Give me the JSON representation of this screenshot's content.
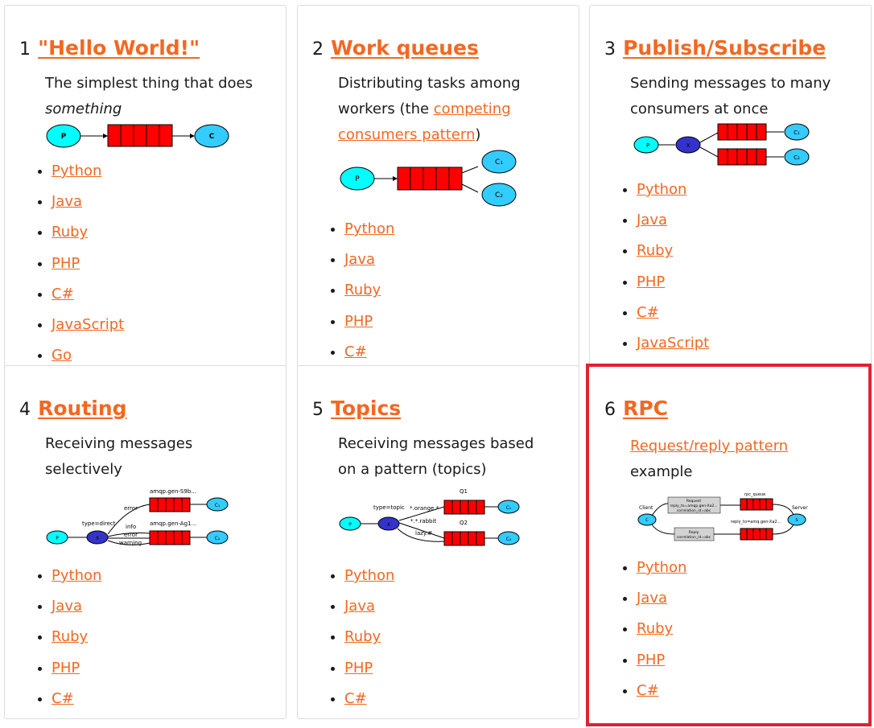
{
  "cards": [
    {
      "number": "1",
      "title": "\"Hello World!\"",
      "desc": {
        "text": "The simplest thing that does",
        "italic": "something"
      },
      "diagram": {
        "p": "P",
        "c": "C"
      },
      "languages": [
        "Python",
        "Java",
        "Ruby",
        "PHP",
        "C#",
        "JavaScript",
        "Go"
      ]
    },
    {
      "number": "2",
      "title": "Work queues",
      "desc": {
        "line1": "Distributing tasks among",
        "line2_pre": "workers (the ",
        "link_a": "competing",
        "link_b": "consumers pattern",
        "tail": ")"
      },
      "diagram": {
        "p": "P",
        "c1": "C₁",
        "c2": "C₂"
      },
      "languages": [
        "Python",
        "Java",
        "Ruby",
        "PHP",
        "C#"
      ]
    },
    {
      "number": "3",
      "title": "Publish/Subscribe",
      "desc": {
        "line1": "Sending messages to many",
        "line2": "consumers at once"
      },
      "diagram": {
        "p": "P",
        "x": "X",
        "c1": "C₁",
        "c2": "C₂"
      },
      "languages": [
        "Python",
        "Java",
        "Ruby",
        "PHP",
        "C#",
        "JavaScript"
      ]
    },
    {
      "number": "4",
      "title": "Routing",
      "desc": {
        "line1": "Receiving messages",
        "line2": "selectively"
      },
      "diagram": {
        "p": "P",
        "x": "X",
        "c1": "C₁",
        "c2": "C₂",
        "type": "type=direct",
        "q1": "amqp.gen-S9b...",
        "q2": "amqp.gen-Ag1...",
        "error1": "error",
        "info": "info",
        "error2": "error",
        "warning": "warning"
      },
      "languages": [
        "Python",
        "Java",
        "Ruby",
        "PHP",
        "C#"
      ]
    },
    {
      "number": "5",
      "title": "Topics",
      "desc": {
        "line1": "Receiving messages based",
        "line2": "on a pattern (topics)"
      },
      "diagram": {
        "p": "P",
        "x": "X",
        "c1": "C₁",
        "c2": "C₂",
        "type": "type=topic",
        "q1": "Q1",
        "q2": "Q2",
        "b1": "*.orange.*",
        "b2": "*.*.rabbit",
        "b3": "lazy.#"
      },
      "languages": [
        "Python",
        "Java",
        "Ruby",
        "PHP",
        "C#"
      ]
    },
    {
      "number": "6",
      "title": "RPC",
      "desc": {
        "link": "Request/reply pattern",
        "line2": "example"
      },
      "diagram": {
        "client": "Client",
        "server": "Server",
        "c": "C",
        "s": "S",
        "rpc_queue": "rpc_queue",
        "reply_queue": "reply_to=amq.gen-Xa2...",
        "req1": "Request",
        "req2": "reply_to=amqp.gen-Xa2...",
        "req3": "correlation_id=abc",
        "rep1": "Reply",
        "rep2": "correlation_id=abc"
      },
      "languages": [
        "Python",
        "Java",
        "Ruby",
        "PHP",
        "C#"
      ]
    }
  ],
  "colors": {
    "link": "#f26822",
    "queue": "#ff0000",
    "producer": "#00ffff",
    "consumer": "#33ccff",
    "exchange": "#3333cc",
    "highlight": "#e0232f"
  }
}
